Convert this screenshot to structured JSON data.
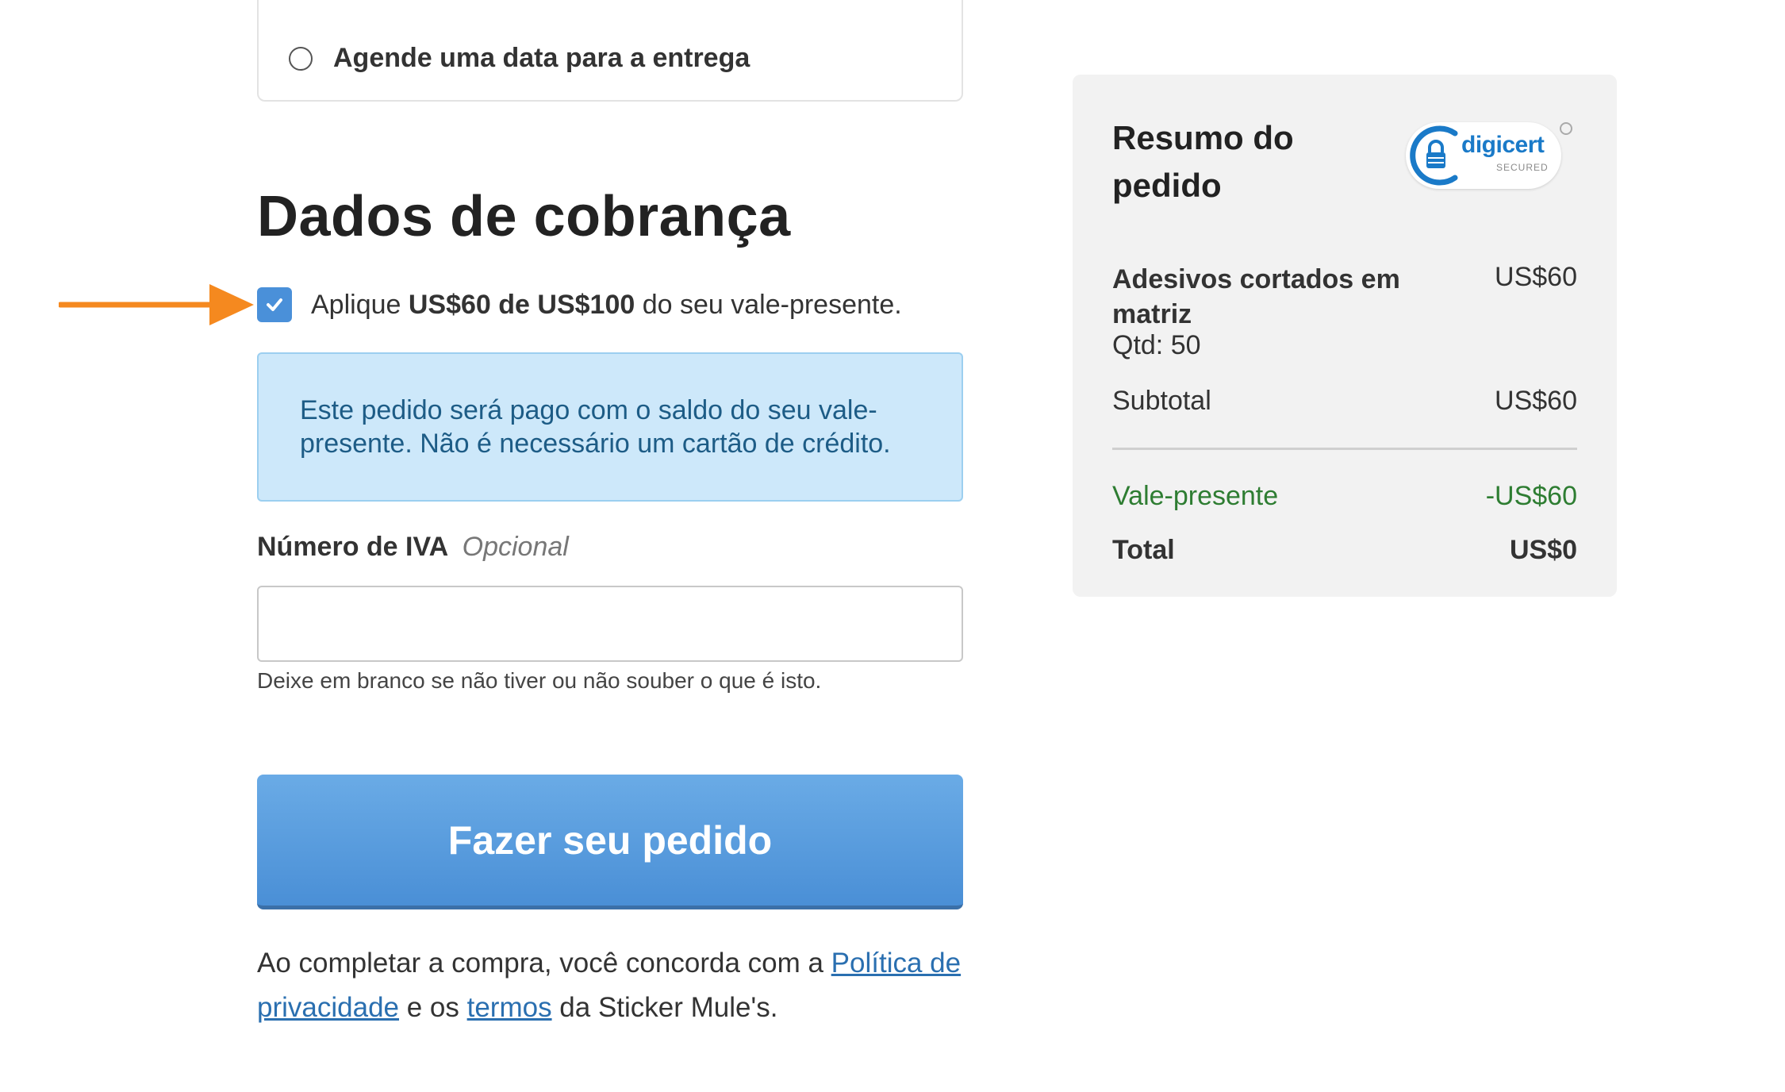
{
  "delivery": {
    "schedule_option_label": "Agende uma data para a entrega"
  },
  "billing": {
    "title": "Dados de cobrança",
    "giftcard": {
      "text_prefix": "Aplique ",
      "amount_text": "US$60 de US$100",
      "text_suffix": " do seu vale-presente.",
      "checked": true
    },
    "info_message": "Este pedido será pago com o saldo do seu vale-presente. Não é necessário um cartão de crédito.",
    "vat": {
      "label": "Número de IVA",
      "optional": "Opcional",
      "value": "",
      "hint": "Deixe em branco se não tiver ou não souber o que é isto."
    },
    "submit_label": "Fazer seu pedido",
    "terms": {
      "prefix": "Ao completar a compra, você concorda com a ",
      "privacy_link": "Política de privacidade",
      "middle": " e os ",
      "terms_link": "termos",
      "suffix": " da Sticker Mule's."
    }
  },
  "summary": {
    "title": "Resumo do pedido",
    "badge": {
      "brand": "digicert",
      "secured": "SECURED"
    },
    "item": {
      "name": "Adesivos cortados em matriz",
      "price": "US$60",
      "qty": "Qtd: 50"
    },
    "subtotal": {
      "label": "Subtotal",
      "value": "US$60"
    },
    "giftcard": {
      "label": "Vale-presente",
      "value": "-US$60"
    },
    "total": {
      "label": "Total",
      "value": "US$0"
    }
  },
  "colors": {
    "accent": "#4a90d9",
    "info_bg": "#cde8fa",
    "info_text": "#1d5c86",
    "arrow": "#f5891f",
    "discount_green": "#2e7d32",
    "link": "#2a6fb0"
  }
}
